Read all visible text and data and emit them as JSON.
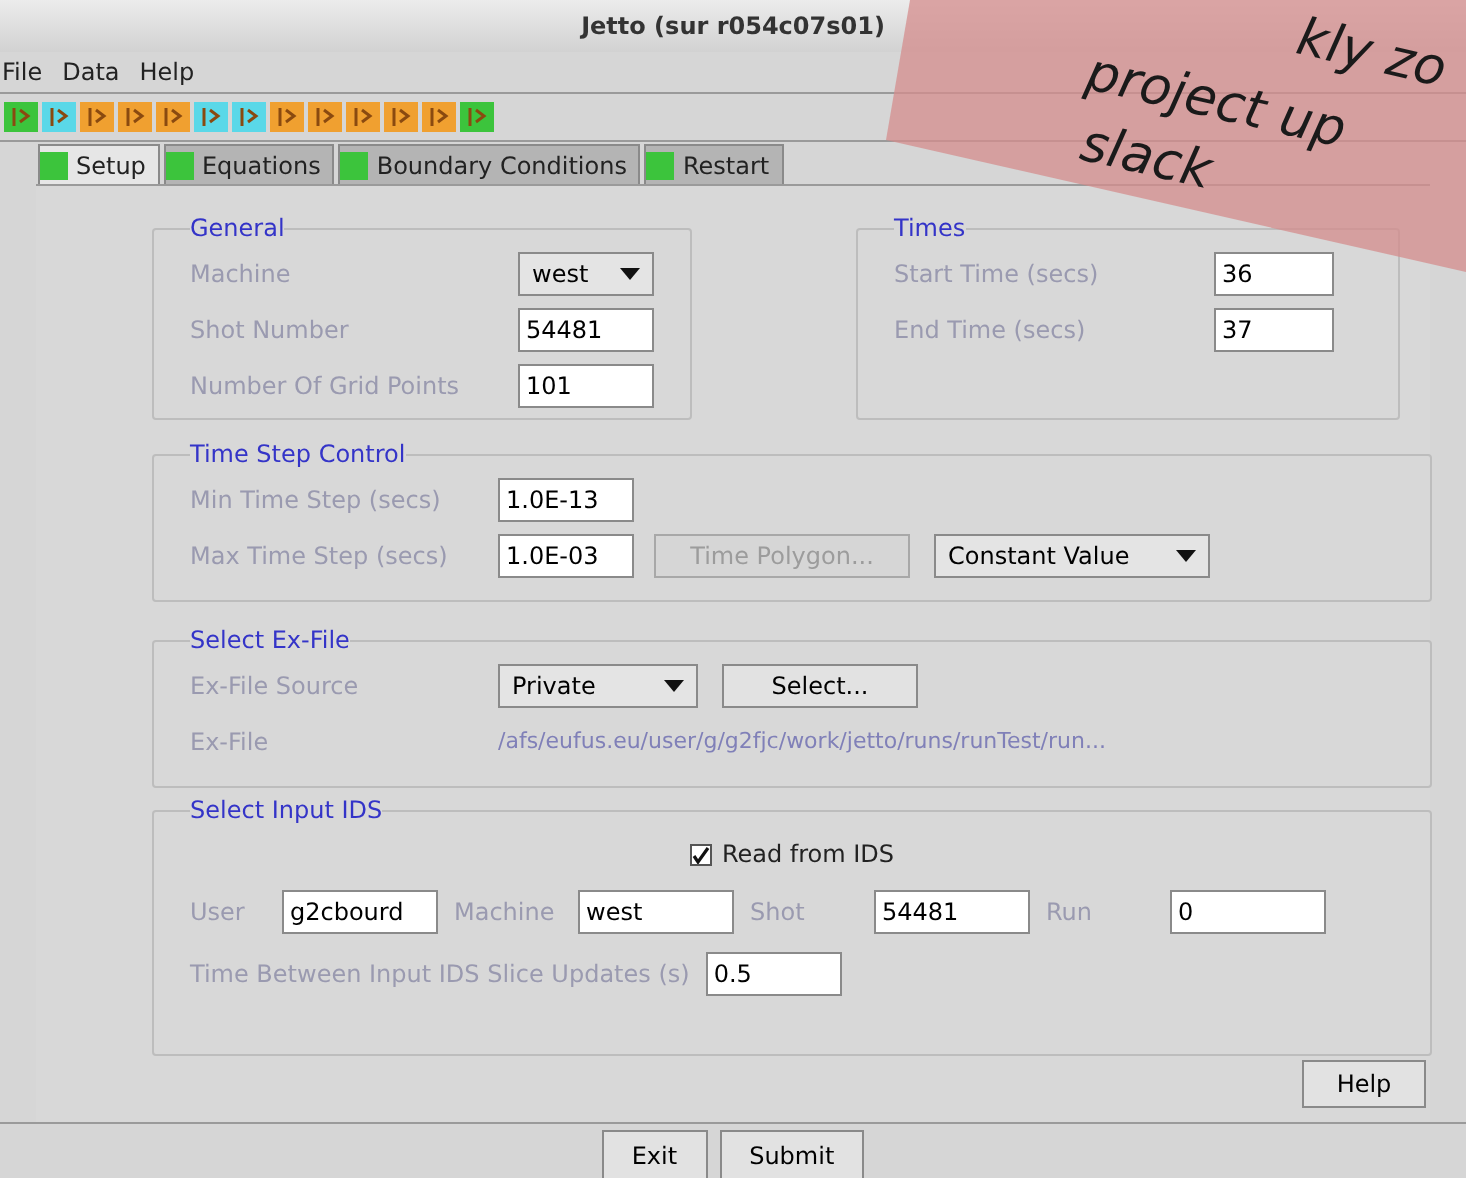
{
  "window": {
    "title": "Jetto (sur r054c07s01)"
  },
  "menu": [
    "File",
    "Data",
    "Help"
  ],
  "toolbar": [
    {
      "color": "#3cc43c"
    },
    {
      "color": "#5ad8e8"
    },
    {
      "color": "#f0a030"
    },
    {
      "color": "#f0a030"
    },
    {
      "color": "#f0a030"
    },
    {
      "color": "#5ad8e8"
    },
    {
      "color": "#5ad8e8"
    },
    {
      "color": "#f0a030"
    },
    {
      "color": "#f0a030"
    },
    {
      "color": "#f0a030"
    },
    {
      "color": "#f0a030"
    },
    {
      "color": "#f0a030"
    },
    {
      "color": "#3cc43c"
    }
  ],
  "tabs": [
    {
      "label": "Setup",
      "selected": true
    },
    {
      "label": "Equations",
      "selected": false
    },
    {
      "label": "Boundary Conditions",
      "selected": false
    },
    {
      "label": "Restart",
      "selected": false
    }
  ],
  "general": {
    "title": "General",
    "fields": [
      {
        "kind": "dropdown",
        "label": "Machine",
        "value": "west"
      },
      {
        "kind": "input",
        "label": "Shot Number",
        "value": "54481"
      },
      {
        "kind": "input",
        "label": "Number Of Grid Points",
        "value": "101"
      }
    ]
  },
  "times": {
    "title": "Times",
    "fields": [
      {
        "kind": "input",
        "label": "Start Time (secs)",
        "value": "36"
      },
      {
        "kind": "input",
        "label": "End Time (secs)",
        "value": "37"
      }
    ]
  },
  "time_step": {
    "title": "Time Step Control",
    "min": {
      "label": "Min Time Step (secs)",
      "value": "1.0E-13"
    },
    "max": {
      "label": "Max Time Step (secs)",
      "value": "1.0E-03"
    },
    "polygon_button": {
      "label": "Time Polygon...",
      "disabled": true
    },
    "mode": "Constant Value"
  },
  "ex_file": {
    "title": "Select Ex-File",
    "source_label": "Ex-File Source",
    "source": "Private",
    "select_button": "Select...",
    "file_label": "Ex-File",
    "file": "/afs/eufus.eu/user/g/g2fjc/work/jetto/runs/runTest/run..."
  },
  "input_ids": {
    "title": "Select Input IDS",
    "read": {
      "label": "Read from IDS",
      "checked": true
    },
    "fields": [
      {
        "label": "User",
        "value": "g2cbourd"
      },
      {
        "label": "Machine",
        "value": "west"
      },
      {
        "label": "Shot",
        "value": "54481"
      },
      {
        "label": "Run",
        "value": "0"
      }
    ],
    "slice": {
      "label": "Time Between Input IDS Slice Updates (s)",
      "value": "0.5"
    }
  },
  "help_button": "Help",
  "buttons": [
    "Exit",
    "Submit"
  ],
  "banner": {
    "lines": [
      "kly zo",
      "project up",
      "slack"
    ]
  }
}
